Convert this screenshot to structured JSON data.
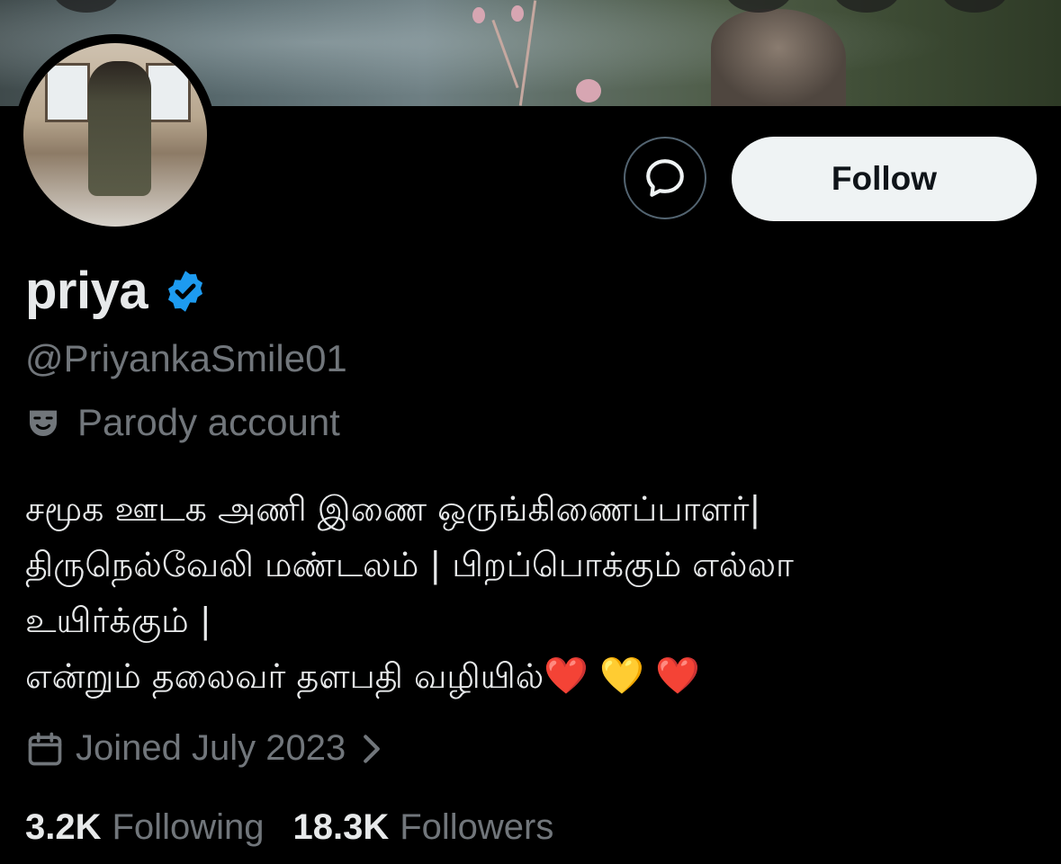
{
  "profile": {
    "name": "priya",
    "handle": "@PriyankaSmile01",
    "label": "Parody account",
    "bio": [
      "சமூக ஊடக அணி இணை ஒருங்கிணைப்பாளர்|",
      "திருநெல்வேலி மண்டலம் | பிறப்பொக்கும் எல்லா",
      "உயிர்க்கும் |",
      "என்றும் தலைவர் தளபதி வழியில்"
    ],
    "bio_hearts": [
      "❤️",
      "💛",
      "❤️"
    ],
    "joined": "Joined July 2023",
    "following_count": "3.2K",
    "following_label": "Following",
    "followers_count": "18.3K",
    "followers_label": "Followers"
  },
  "actions": {
    "follow_label": "Follow",
    "message_icon": "message-bubble-icon"
  },
  "colors": {
    "background": "#000000",
    "primary_text": "#e7e9ea",
    "secondary_text": "#71767b",
    "verified_blue": "#1d9bf0",
    "follow_bg": "#eff3f4"
  }
}
